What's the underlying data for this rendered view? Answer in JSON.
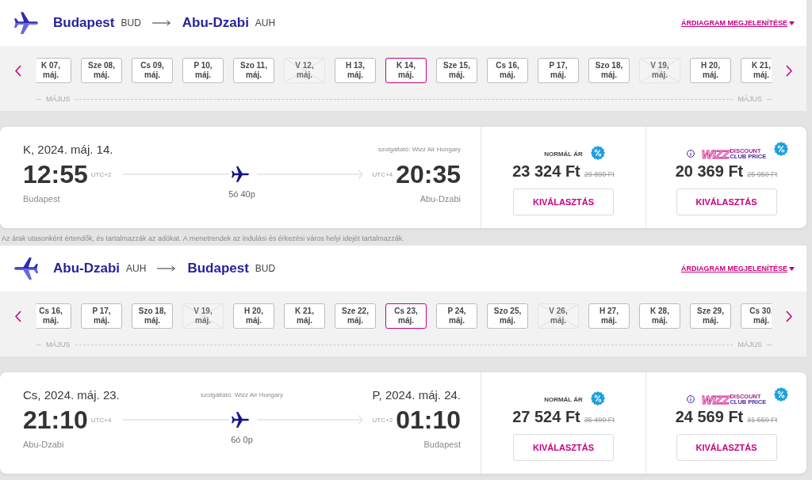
{
  "outbound": {
    "kind": "outbound",
    "from_city": "Budapest",
    "from_code": "BUD",
    "to_city": "Abu-Dzabi",
    "to_code": "AUH",
    "chart_link": "ÁRDIAGRAM MEGJELENÍTÉSE",
    "dates": [
      {
        "day": "K 07,",
        "month": "máj.",
        "selected": false,
        "disabled": false
      },
      {
        "day": "Sze 08,",
        "month": "máj.",
        "selected": false,
        "disabled": false
      },
      {
        "day": "Cs 09,",
        "month": "máj.",
        "selected": false,
        "disabled": false
      },
      {
        "day": "P 10,",
        "month": "máj.",
        "selected": false,
        "disabled": false
      },
      {
        "day": "Szo 11,",
        "month": "máj.",
        "selected": false,
        "disabled": false
      },
      {
        "day": "V 12,",
        "month": "máj.",
        "selected": false,
        "disabled": true
      },
      {
        "day": "H 13,",
        "month": "máj.",
        "selected": false,
        "disabled": false
      },
      {
        "day": "K 14,",
        "month": "máj.",
        "selected": true,
        "disabled": false
      },
      {
        "day": "Sze 15,",
        "month": "máj.",
        "selected": false,
        "disabled": false
      },
      {
        "day": "Cs 16,",
        "month": "máj.",
        "selected": false,
        "disabled": false
      },
      {
        "day": "P 17,",
        "month": "máj.",
        "selected": false,
        "disabled": false
      },
      {
        "day": "Szo 18,",
        "month": "máj.",
        "selected": false,
        "disabled": false
      },
      {
        "day": "V 19,",
        "month": "máj.",
        "selected": false,
        "disabled": true
      },
      {
        "day": "H 20,",
        "month": "máj.",
        "selected": false,
        "disabled": false
      },
      {
        "day": "K 21,",
        "month": "máj.",
        "selected": false,
        "disabled": false
      }
    ],
    "month_labels": [
      "MÁJUS",
      "MÁJUS"
    ],
    "flight": {
      "departure_date": "K, 2024. máj. 14.",
      "operator": "szolgáltató: Wizz Air Hungary",
      "departure_time": "12:55",
      "departure_utc": "UTC+2",
      "arrival_utc": "UTC+4",
      "arrival_time": "20:35",
      "departure_city": "Budapest",
      "duration": "5ó 40p",
      "arrival_city": "Abu-Dzabi",
      "fares": [
        {
          "kind": "normal",
          "label": "NORMÁL ÁR",
          "price": "23 324 Ft",
          "old_price": "29 890 Ft",
          "button": "KIVÁLASZTÁS"
        },
        {
          "kind": "club",
          "logo_word": "WIZZ",
          "logo_lines": [
            "DISCOUNT",
            "CLUB PRICE"
          ],
          "price": "20 369 Ft",
          "old_price": "25 950 Ft",
          "button": "KIVÁLASZTÁS"
        }
      ]
    }
  },
  "note": "Az árak utasonként értendők, és tartalmazzák az adókat. A menetrendek az indulási és érkezési város helyi idejét tartalmazzák.",
  "inbound": {
    "kind": "return",
    "from_city": "Abu-Dzabi",
    "from_code": "AUH",
    "to_city": "Budapest",
    "to_code": "BUD",
    "chart_link": "ÁRDIAGRAM MEGJELENÍTÉSE",
    "dates": [
      {
        "day": "Cs 16,",
        "month": "máj.",
        "selected": false,
        "disabled": false
      },
      {
        "day": "P 17,",
        "month": "máj.",
        "selected": false,
        "disabled": false
      },
      {
        "day": "Szo 18,",
        "month": "máj.",
        "selected": false,
        "disabled": false
      },
      {
        "day": "V 19,",
        "month": "máj.",
        "selected": false,
        "disabled": true
      },
      {
        "day": "H 20,",
        "month": "máj.",
        "selected": false,
        "disabled": false
      },
      {
        "day": "K 21,",
        "month": "máj.",
        "selected": false,
        "disabled": false
      },
      {
        "day": "Sze 22,",
        "month": "máj.",
        "selected": false,
        "disabled": false
      },
      {
        "day": "Cs 23,",
        "month": "máj.",
        "selected": true,
        "disabled": false
      },
      {
        "day": "P 24,",
        "month": "máj.",
        "selected": false,
        "disabled": false
      },
      {
        "day": "Szo 25,",
        "month": "máj.",
        "selected": false,
        "disabled": false
      },
      {
        "day": "V 26,",
        "month": "máj.",
        "selected": false,
        "disabled": true
      },
      {
        "day": "H 27,",
        "month": "máj.",
        "selected": false,
        "disabled": false
      },
      {
        "day": "K 28,",
        "month": "máj.",
        "selected": false,
        "disabled": false
      },
      {
        "day": "Sze 29,",
        "month": "máj.",
        "selected": false,
        "disabled": false
      },
      {
        "day": "Cs 30,",
        "month": "máj.",
        "selected": false,
        "disabled": false
      }
    ],
    "month_labels": [
      "MÁJUS",
      "MÁJUS"
    ],
    "flight": {
      "departure_date": "Cs, 2024. máj. 23.",
      "operator": "szolgáltató: Wizz Air Hungary",
      "arrival_date": "P, 2024. máj. 24.",
      "departure_time": "21:10",
      "departure_utc": "UTC+4",
      "arrival_utc": "UTC+2",
      "arrival_time": "01:10",
      "departure_city": "Abu-Dzabi",
      "duration": "6ó 0p",
      "arrival_city": "Budapest",
      "fares": [
        {
          "kind": "normal",
          "label": "NORMÁL ÁR",
          "price": "27 524 Ft",
          "old_price": "35 490 Ft",
          "button": "KIVÁLASZTÁS"
        },
        {
          "kind": "club",
          "logo_word": "WIZZ",
          "logo_lines": [
            "DISCOUNT",
            "CLUB PRICE"
          ],
          "price": "24 569 Ft",
          "old_price": "31 550 Ft",
          "button": "KIVÁLASZTÁS"
        }
      ]
    }
  }
}
